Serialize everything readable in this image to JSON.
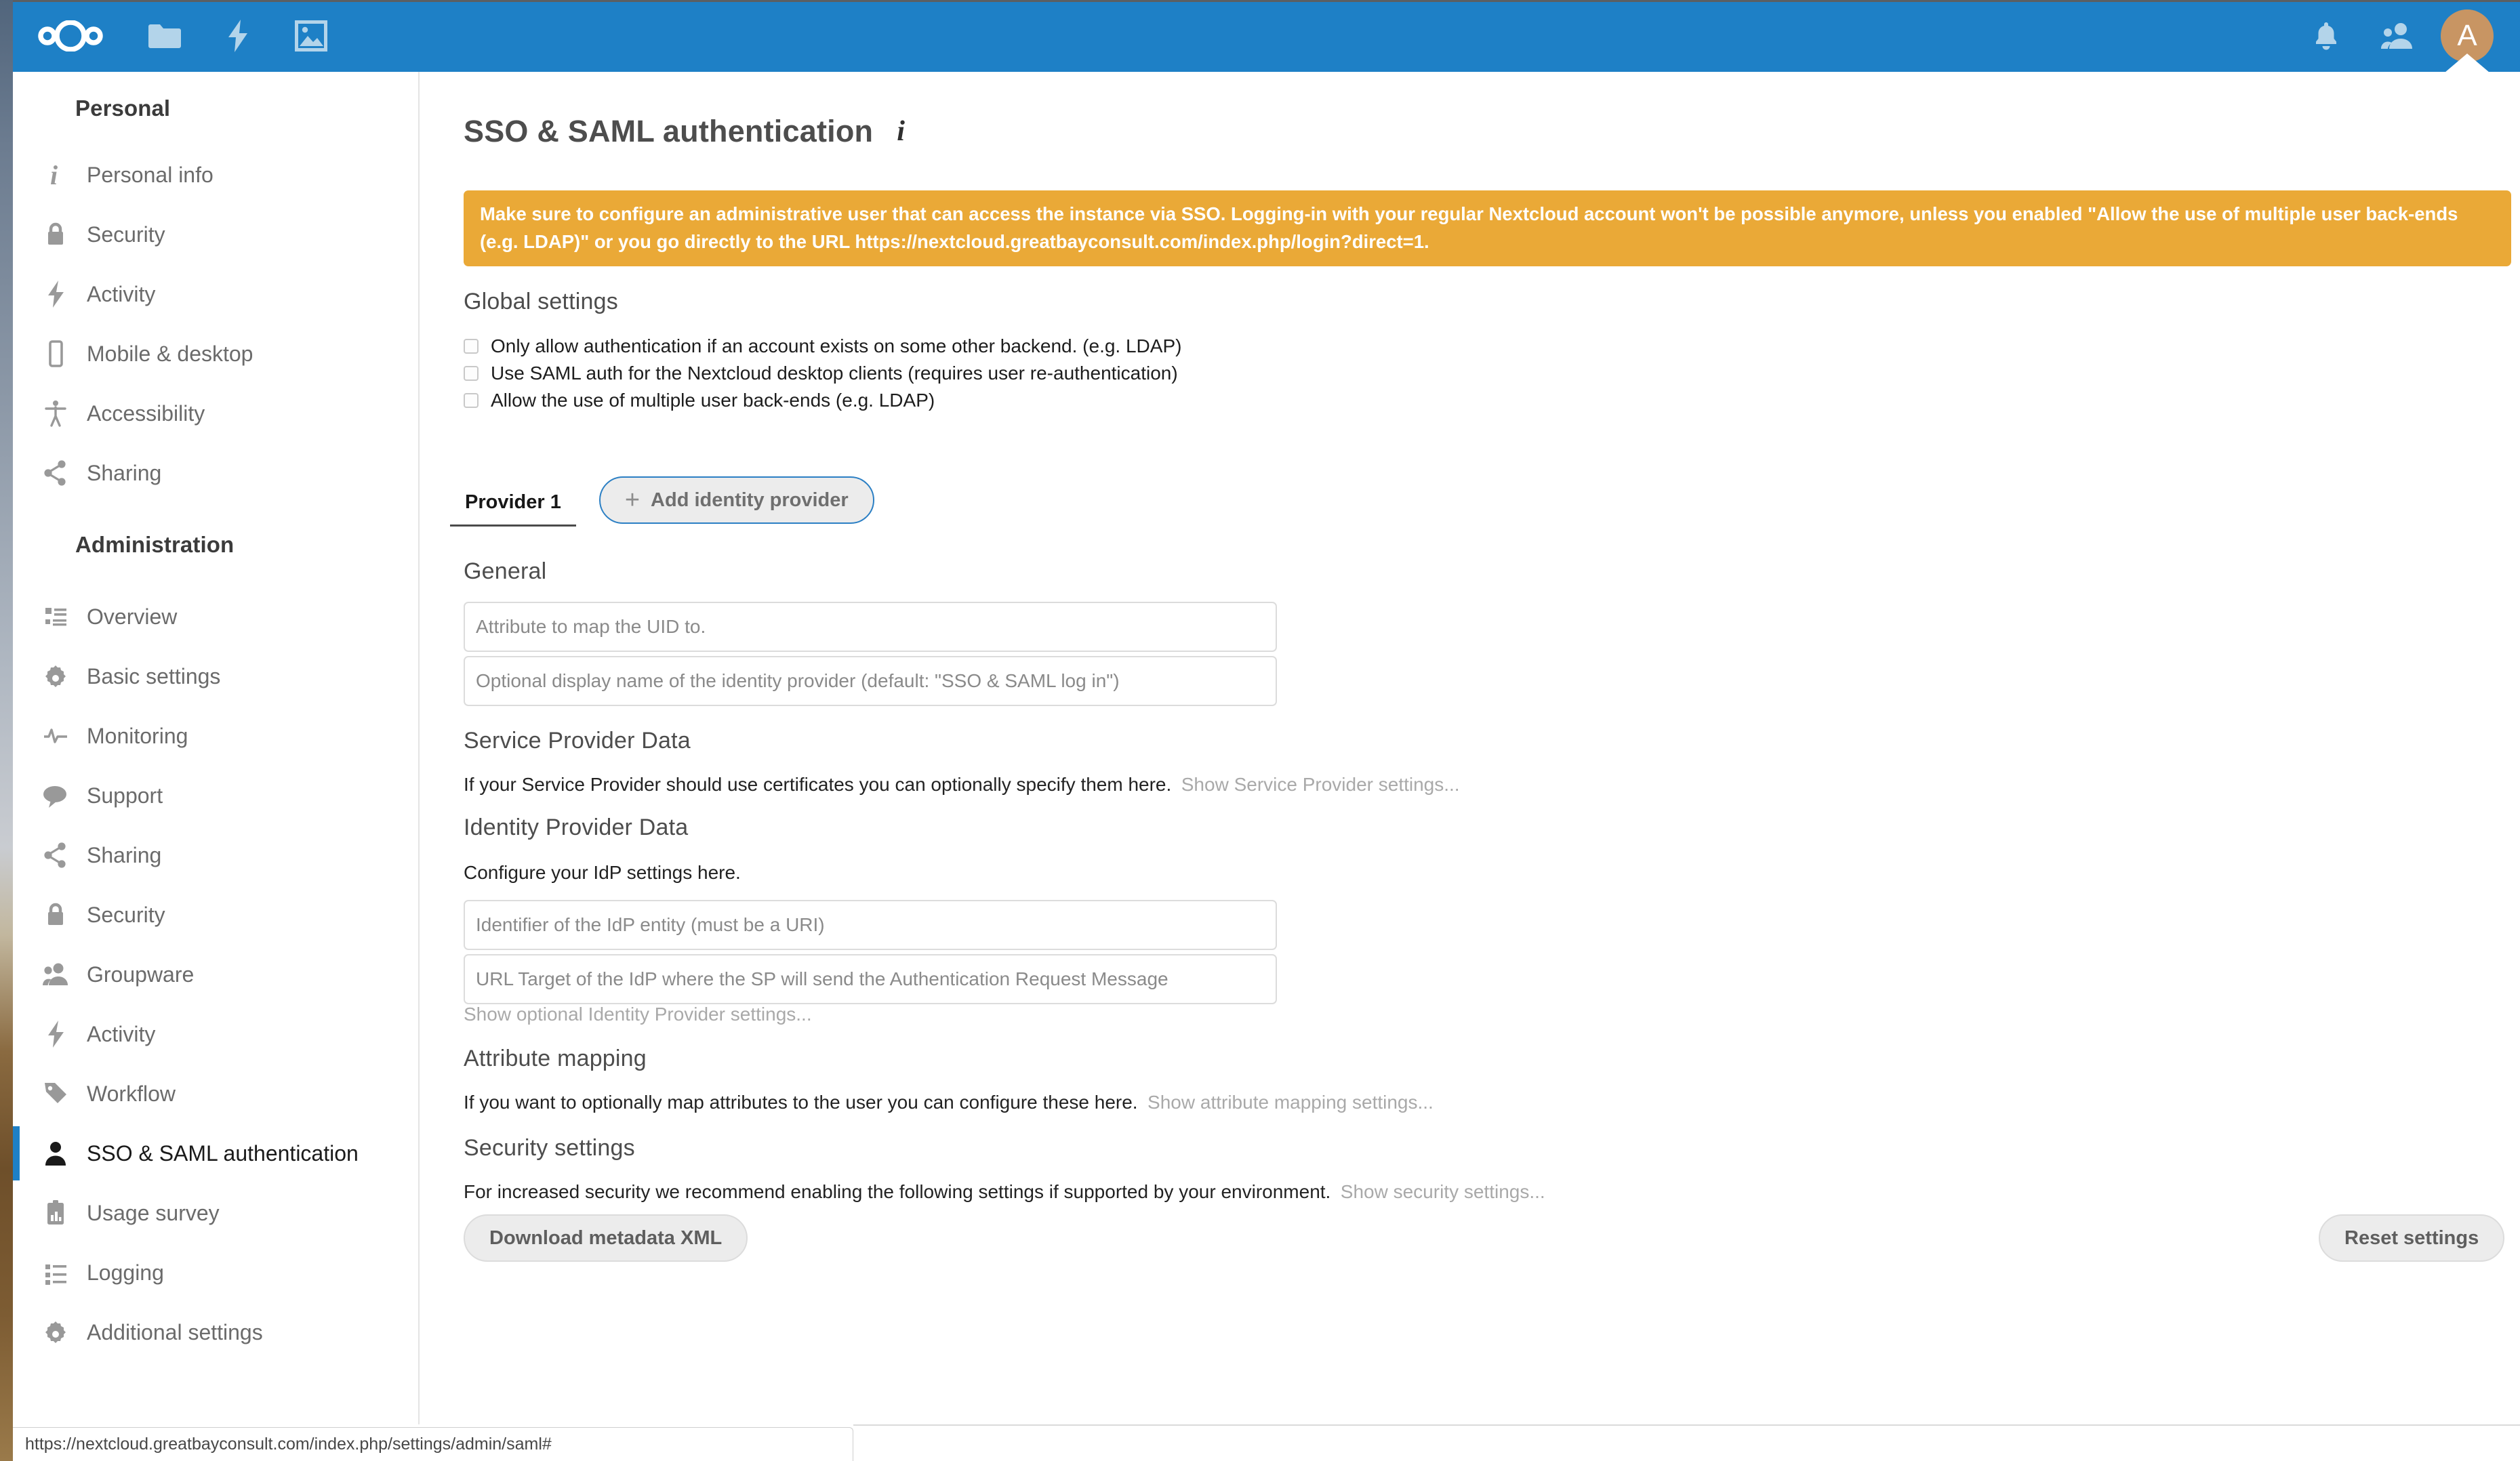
{
  "header": {
    "logo_name": "nextcloud-logo",
    "accent_color": "#1e80c6",
    "avatar_initial": "A",
    "avatar_color": "#c89563",
    "apps": [
      {
        "name": "files-app-icon",
        "label": "Files"
      },
      {
        "name": "activity-app-icon",
        "label": "Activity"
      },
      {
        "name": "photos-app-icon",
        "label": "Photos"
      }
    ],
    "right_icons": [
      {
        "name": "notifications-bell-icon",
        "label": "Notifications"
      },
      {
        "name": "contacts-icon",
        "label": "Contacts"
      }
    ]
  },
  "sidebar": {
    "groups": [
      {
        "caption": "Personal",
        "items": [
          {
            "label": "Personal info",
            "icon": "info-icon",
            "active": false
          },
          {
            "label": "Security",
            "icon": "lock-icon",
            "active": false
          },
          {
            "label": "Activity",
            "icon": "lightning-icon",
            "active": false
          },
          {
            "label": "Mobile & desktop",
            "icon": "phone-icon",
            "active": false
          },
          {
            "label": "Accessibility",
            "icon": "accessibility-icon",
            "active": false
          },
          {
            "label": "Sharing",
            "icon": "share-icon",
            "active": false
          }
        ]
      },
      {
        "caption": "Administration",
        "items": [
          {
            "label": "Overview",
            "icon": "list-icon",
            "active": false
          },
          {
            "label": "Basic settings",
            "icon": "gear-icon",
            "active": false
          },
          {
            "label": "Monitoring",
            "icon": "pulse-icon",
            "active": false
          },
          {
            "label": "Support",
            "icon": "speech-bubble-icon",
            "active": false
          },
          {
            "label": "Sharing",
            "icon": "share-icon",
            "active": false
          },
          {
            "label": "Security",
            "icon": "lock-icon",
            "active": false
          },
          {
            "label": "Groupware",
            "icon": "group-icon",
            "active": false
          },
          {
            "label": "Activity",
            "icon": "lightning-icon",
            "active": false
          },
          {
            "label": "Workflow",
            "icon": "tag-icon",
            "active": false
          },
          {
            "label": "SSO & SAML authentication",
            "icon": "user-icon",
            "active": true
          },
          {
            "label": "Usage survey",
            "icon": "clipboard-chart-icon",
            "active": false
          },
          {
            "label": "Logging",
            "icon": "list-icon",
            "active": false
          },
          {
            "label": "Additional settings",
            "icon": "gear-icon",
            "active": false
          }
        ]
      }
    ]
  },
  "page": {
    "title": "SSO & SAML authentication",
    "info_icon_glyph": "i"
  },
  "warning": {
    "color": "#eaa937",
    "text_part1": "Make sure to configure an administrative user that can access the instance via SSO. Logging-in with your regular Nextcloud account won't be possible anymore, unless you enabled \"Allow the use of multiple user back-ends (e.g. LDAP)\" or you go directly to the URL ",
    "url": "https://nextcloud.greatbayconsult.com/index.php/login?direct=1",
    "text_part2": "."
  },
  "global_settings": {
    "heading": "Global settings",
    "checkboxes": [
      {
        "label": "Only allow authentication if an account exists on some other backend. (e.g. LDAP)",
        "checked": false
      },
      {
        "label": "Use SAML auth for the Nextcloud desktop clients (requires user re-authentication)",
        "checked": false
      },
      {
        "label": "Allow the use of multiple user back-ends (e.g. LDAP)",
        "checked": false
      }
    ]
  },
  "provider_tabs": {
    "tabs": [
      {
        "label": "Provider 1",
        "active": true
      }
    ],
    "add_button_label": "Add identity provider",
    "add_button_plus": "+"
  },
  "general": {
    "heading": "General",
    "uid_field": {
      "value": "",
      "placeholder": "Attribute to map the UID to."
    },
    "display_name_field": {
      "value": "",
      "placeholder": "Optional display name of the identity provider (default: \"SSO & SAML log in\")"
    }
  },
  "service_provider": {
    "heading": "Service Provider Data",
    "description": "If your Service Provider should use certificates you can optionally specify them here.",
    "toggle_link": "Show Service Provider settings..."
  },
  "identity_provider": {
    "heading": "Identity Provider Data",
    "description": "Configure your IdP settings here.",
    "entity_field": {
      "value": "",
      "placeholder": "Identifier of the IdP entity (must be a URI)"
    },
    "url_field": {
      "value": "",
      "placeholder": "URL Target of the IdP where the SP will send the Authentication Request Message"
    },
    "toggle_link": "Show optional Identity Provider settings..."
  },
  "attribute_mapping": {
    "heading": "Attribute mapping",
    "description": "If you want to optionally map attributes to the user you can configure these here.",
    "toggle_link": "Show attribute mapping settings..."
  },
  "security_settings": {
    "heading": "Security settings",
    "description": "For increased security we recommend enabling the following settings if supported by your environment.",
    "toggle_link": "Show security settings...",
    "download_button_label": "Download metadata XML"
  },
  "reset": {
    "button_label": "Reset settings"
  },
  "statusbar": {
    "url": "https://nextcloud.greatbayconsult.com/index.php/settings/admin/saml#"
  }
}
